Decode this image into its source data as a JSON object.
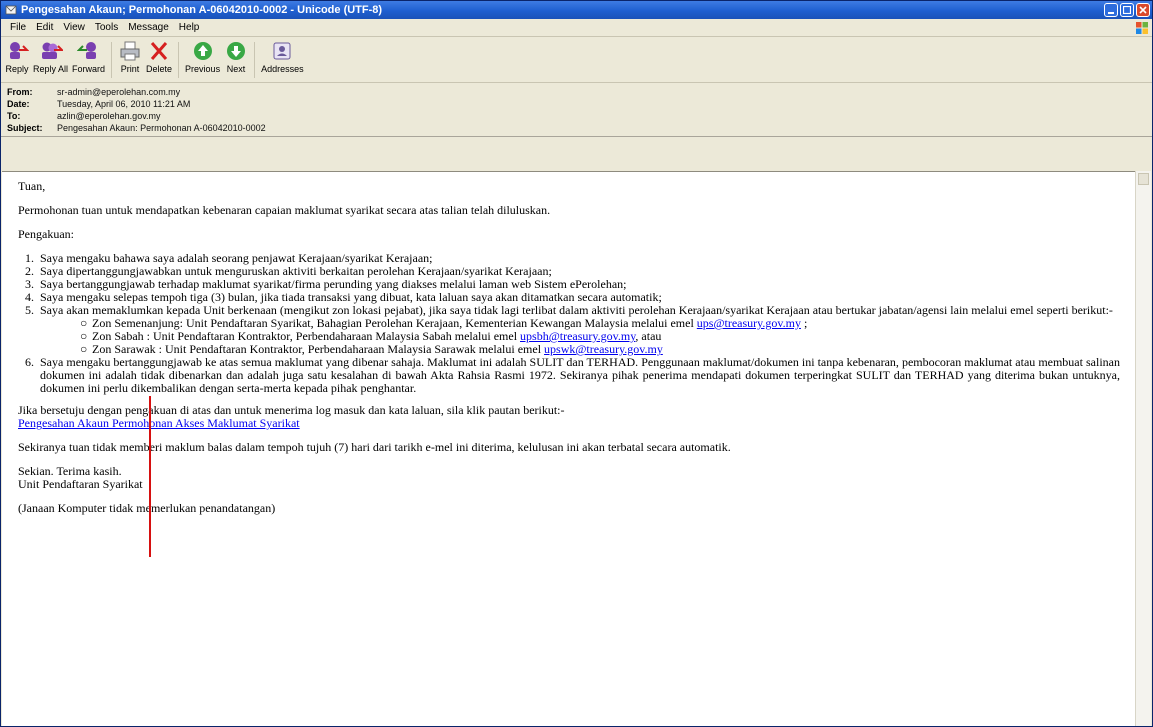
{
  "window": {
    "title": "Pengesahan Akaun; Permohonan A-06042010-0002 - Unicode (UTF-8)"
  },
  "menu": [
    "File",
    "Edit",
    "View",
    "Tools",
    "Message",
    "Help"
  ],
  "toolbar": {
    "reply": "Reply",
    "reply_all": "Reply All",
    "forward": "Forward",
    "print": "Print",
    "delete": "Delete",
    "previous": "Previous",
    "next": "Next",
    "addresses": "Addresses"
  },
  "header": {
    "from_label": "From:",
    "from": "sr-admin@eperolehan.com.my",
    "date_label": "Date:",
    "date": "Tuesday, April 06, 2010 11:21 AM",
    "to_label": "To:",
    "to": "azlin@eperolehan.gov.my",
    "subject_label": "Subject:",
    "subject": "Pengesahan Akaun: Permohonan A-06042010-0002"
  },
  "body": {
    "greeting": "Tuan,",
    "intro": "Permohonan tuan untuk mendapatkan kebenaran capaian maklumat syarikat secara atas talian telah diluluskan.",
    "pengakuan": "Pengakuan:",
    "items": [
      {
        "num": "1.",
        "text": "Saya mengaku bahawa saya adalah seorang penjawat Kerajaan/syarikat Kerajaan;"
      },
      {
        "num": "2.",
        "text": "Saya dipertanggungjawabkan untuk menguruskan aktiviti berkaitan perolehan Kerajaan/syarikat Kerajaan;"
      },
      {
        "num": "3.",
        "text": "Saya bertanggungjawab terhadap maklumat syarikat/firma perunding yang diakses melalui laman web Sistem ePerolehan;"
      },
      {
        "num": "4.",
        "text": "Saya mengaku selepas tempoh tiga (3) bulan, jika tiada transaksi yang dibuat, kata laluan saya akan ditamatkan secara automatik;"
      },
      {
        "num": "5.",
        "text": "Saya akan memaklumkan kepada Unit berkenaan (mengikut zon lokasi pejabat), jika saya tidak lagi terlibat dalam aktiviti perolehan Kerajaan/syarikat Kerajaan atau bertukar jabatan/agensi lain melalui emel seperti berikut:-"
      },
      {
        "num": "6.",
        "text": "Saya mengaku bertanggungjawab ke atas semua maklumat yang dibenar sahaja. Maklumat ini adalah SULIT dan TERHAD. Penggunaan maklumat/dokumen ini tanpa kebenaran, pembocoran maklumat atau membuat salinan dokumen ini adalah tidak dibenarkan dan adalah juga satu kesalahan di bawah Akta Rahsia Rasmi 1972. Sekiranya pihak penerima mendapati dokumen terperingkat SULIT dan TERHAD yang diterima bukan untuknya, dokumen ini perlu dikembalikan dengan serta-merta kepada pihak penghantar."
      }
    ],
    "zones": [
      {
        "text": "Zon Semenanjung: Unit Pendaftaran Syarikat, Bahagian Perolehan Kerajaan, Kementerian Kewangan Malaysia melalui emel ",
        "link": "ups@treasury.gov.my",
        "after": " ;"
      },
      {
        "text": "Zon Sabah : Unit Pendaftaran Kontraktor, Perbendaharaan Malaysia Sabah melalui emel ",
        "link": "upsbh@treasury.gov.my",
        "after": ", atau"
      },
      {
        "text": "Zon Sarawak : Unit Pendaftaran Kontraktor, Perbendaharaan Malaysia Sarawak melalui emel ",
        "link": "upswk@treasury.gov.my",
        "after": ""
      }
    ],
    "agree": "Jika bersetuju dengan pengakuan di atas dan untuk menerima log masuk dan kata laluan, sila klik pautan berikut:-",
    "link": "Pengesahan Akaun Permohonan Akses Maklumat Syarikat",
    "reminder": "Sekiranya tuan tidak memberi maklum balas dalam tempoh tujuh (7) hari dari tarikh e-mel ini diterima, kelulusan ini akan terbatal secara automatik.",
    "closing": "Sekian. Terima kasih.",
    "signature": "Unit Pendaftaran Syarikat",
    "note": "(Janaan Komputer tidak memerlukan penandatangan)"
  }
}
